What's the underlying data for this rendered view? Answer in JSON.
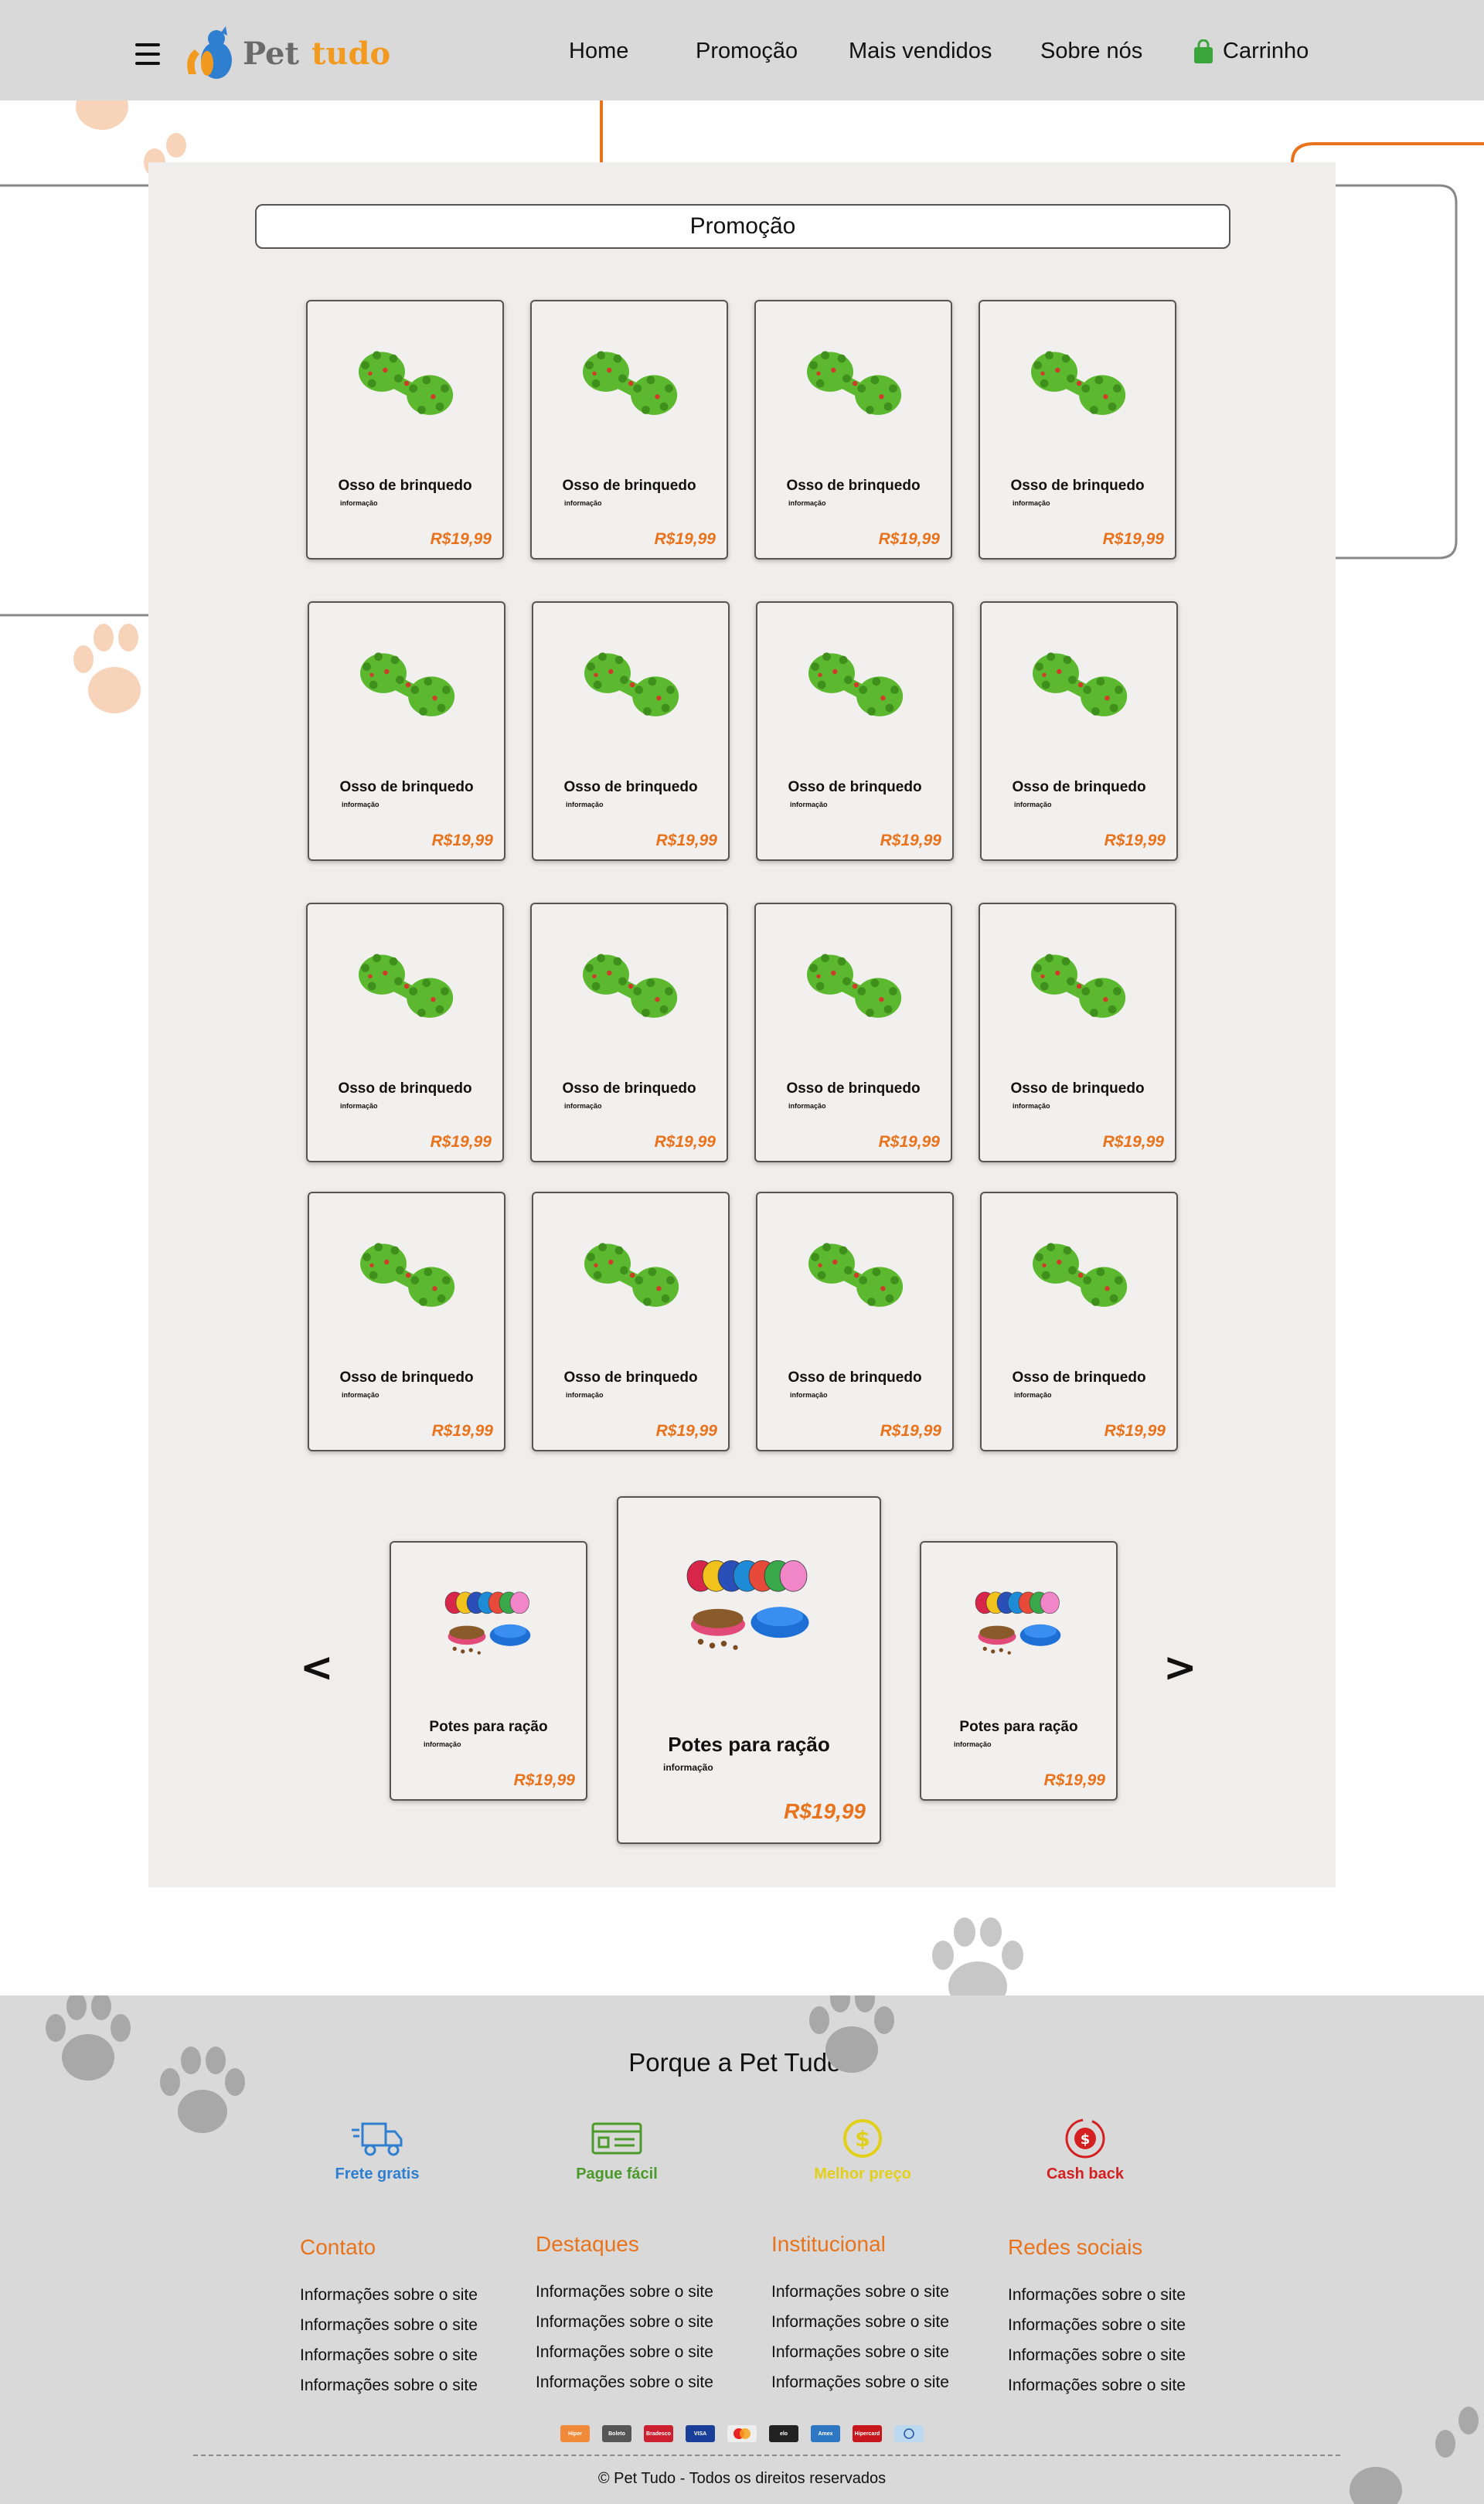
{
  "brand": {
    "name_part1": "Pet",
    "name_part2": "tudo"
  },
  "nav": {
    "items": [
      {
        "label": "Home"
      },
      {
        "label": "Promoção"
      },
      {
        "label": "Mais vendidos"
      },
      {
        "label": "Sobre nós"
      },
      {
        "label": "Carrinho",
        "icon": "shopping-bag-icon"
      }
    ]
  },
  "promo": {
    "title": "Promoção",
    "products": [
      {
        "name": "Osso de brinquedo",
        "info": "informação",
        "price": "R$19,99"
      },
      {
        "name": "Osso de brinquedo",
        "info": "informação",
        "price": "R$19,99"
      },
      {
        "name": "Osso de brinquedo",
        "info": "informação",
        "price": "R$19,99"
      },
      {
        "name": "Osso de brinquedo",
        "info": "informação",
        "price": "R$19,99"
      },
      {
        "name": "Osso de brinquedo",
        "info": "informação",
        "price": "R$19,99"
      },
      {
        "name": "Osso de brinquedo",
        "info": "informação",
        "price": "R$19,99"
      },
      {
        "name": "Osso de brinquedo",
        "info": "informação",
        "price": "R$19,99"
      },
      {
        "name": "Osso de brinquedo",
        "info": "informação",
        "price": "R$19,99"
      },
      {
        "name": "Osso de brinquedo",
        "info": "informação",
        "price": "R$19,99"
      },
      {
        "name": "Osso de brinquedo",
        "info": "informação",
        "price": "R$19,99"
      },
      {
        "name": "Osso de brinquedo",
        "info": "informação",
        "price": "R$19,99"
      },
      {
        "name": "Osso de brinquedo",
        "info": "informação",
        "price": "R$19,99"
      },
      {
        "name": "Osso de brinquedo",
        "info": "informação",
        "price": "R$19,99"
      },
      {
        "name": "Osso de brinquedo",
        "info": "informação",
        "price": "R$19,99"
      },
      {
        "name": "Osso de brinquedo",
        "info": "informação",
        "price": "R$19,99"
      },
      {
        "name": "Osso de brinquedo",
        "info": "informação",
        "price": "R$19,99"
      }
    ]
  },
  "carousel": {
    "prev_label": "<",
    "next_label": ">",
    "items": [
      {
        "name": "Potes para ração",
        "info": "informação",
        "price": "R$19,99"
      },
      {
        "name": "Potes para ração",
        "info": "informação",
        "price": "R$19,99"
      },
      {
        "name": "Potes para ração",
        "info": "informação",
        "price": "R$19,99"
      }
    ]
  },
  "footer": {
    "why_title": "Porque a Pet Tudo?",
    "features": [
      {
        "label": "Frete gratis",
        "color": "#2f7fd0",
        "icon": "truck-icon"
      },
      {
        "label": "Pague fácil",
        "color": "#4a9a2a",
        "icon": "payment-icon"
      },
      {
        "label": "Melhor preço",
        "color": "#e2cf1a",
        "icon": "coin-icon"
      },
      {
        "label": "Cash back",
        "color": "#d42020",
        "icon": "cashback-icon"
      }
    ],
    "columns": [
      {
        "title": "Contato",
        "links": [
          "Informações sobre o site",
          "Informações sobre o site",
          "Informações sobre o site",
          "Informações sobre o site"
        ]
      },
      {
        "title": "Destaques",
        "links": [
          "Informações sobre o site",
          "Informações sobre o site",
          "Informações sobre o site",
          "Informações sobre o site"
        ]
      },
      {
        "title": "Institucional",
        "links": [
          "Informações sobre o site",
          "Informações sobre o site",
          "Informações sobre o site",
          "Informações sobre o site"
        ]
      },
      {
        "title": "Redes sociais",
        "links": [
          "Informações sobre o site",
          "Informações sobre o site",
          "Informações sobre o site",
          "Informações sobre o site"
        ]
      }
    ],
    "payment_methods": [
      "Hiper",
      "Boleto",
      "Bradesco",
      "VISA",
      "Mastercard",
      "elo",
      "Amex",
      "Hipercard",
      "Diners"
    ],
    "copyright": "© Pet Tudo - Todos os direitos reservados"
  },
  "colors": {
    "accent": "#e8731c",
    "header_bg": "#d9d9d9",
    "panel_bg": "#f0eeed",
    "brand_orange": "#f29a1f"
  }
}
